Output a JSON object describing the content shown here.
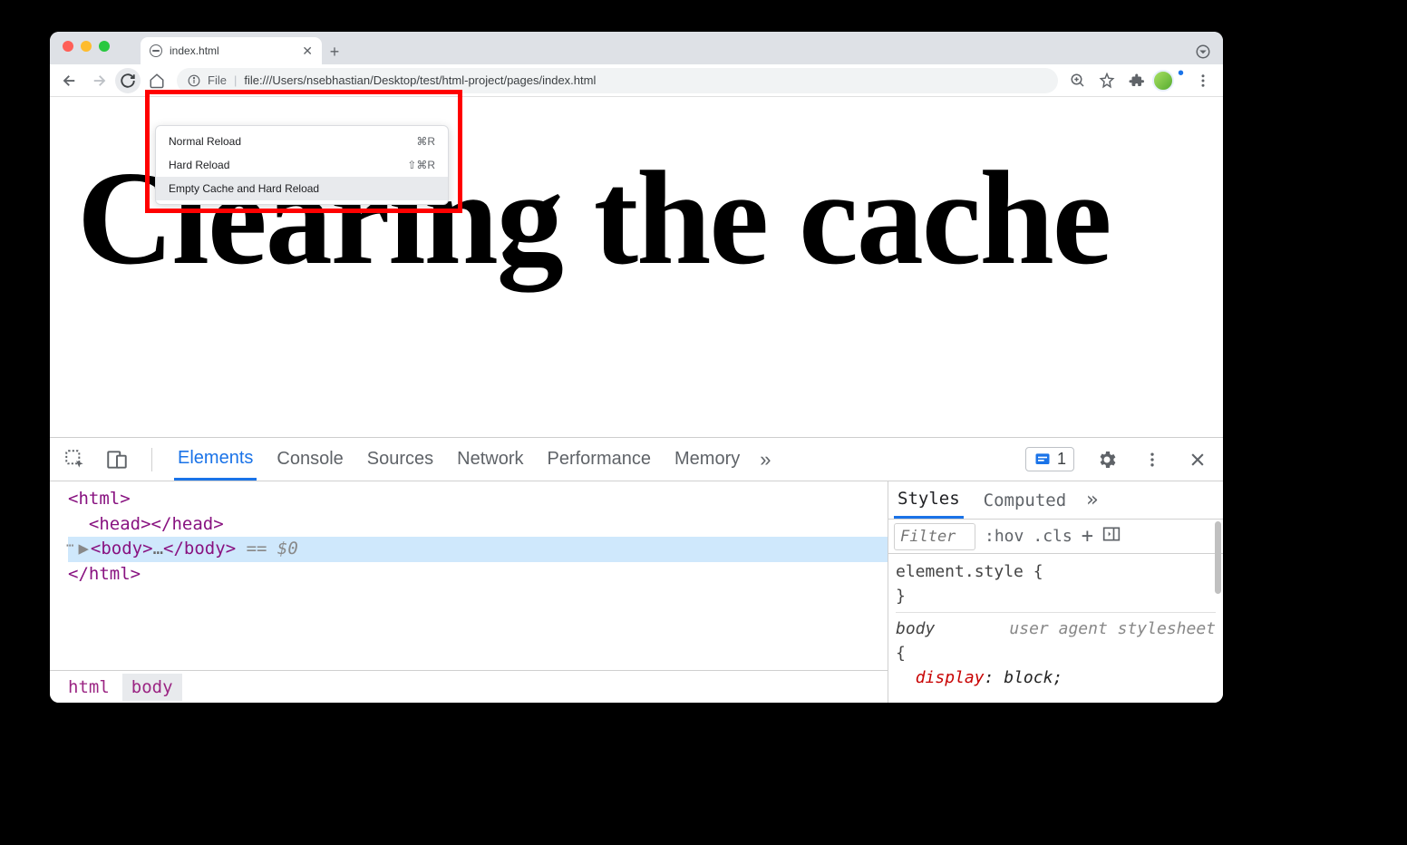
{
  "tab": {
    "title": "index.html"
  },
  "omnibox": {
    "protocol": "File",
    "url": "file:///Users/nsebhastian/Desktop/test/html-project/pages/index.html"
  },
  "context_menu": {
    "items": [
      {
        "label": "Normal Reload",
        "shortcut": "⌘R"
      },
      {
        "label": "Hard Reload",
        "shortcut": "⇧⌘R"
      },
      {
        "label": "Empty Cache and Hard Reload",
        "shortcut": ""
      }
    ]
  },
  "page": {
    "heading": "Clearing the cache"
  },
  "devtools": {
    "tabs": [
      "Elements",
      "Console",
      "Sources",
      "Network",
      "Performance",
      "Memory"
    ],
    "badge_count": "1",
    "code": {
      "line1_open": "<html>",
      "line2": "<head></head>",
      "line3_open": "<body>",
      "line3_close": "</body>",
      "line3_suffix": " == $0",
      "line4": "</html>"
    },
    "breadcrumbs": [
      "html",
      "body"
    ],
    "styles": {
      "tabs": [
        "Styles",
        "Computed"
      ],
      "filter_placeholder": "Filter",
      "tools": {
        "hov": ":hov",
        "cls": ".cls",
        "plus": "+"
      },
      "rule1_open": "element.style {",
      "rule1_close": "}",
      "rule2_sel": "body",
      "rule2_src": "user agent stylesheet",
      "rule2_open": "{",
      "rule2_prop": "display",
      "rule2_val": "block"
    }
  }
}
